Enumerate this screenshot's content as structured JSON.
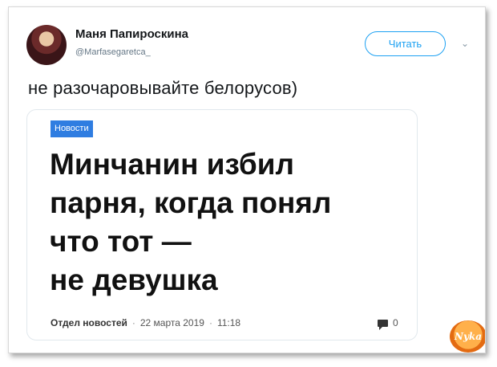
{
  "tweet": {
    "author_name": "Маня Папироскина",
    "author_handle": "@Marfasegaretca_",
    "follow_label": "Читать",
    "caret": "⌄",
    "text": "не разочаровывайте белорусов)"
  },
  "card": {
    "badge": "Новости",
    "headline_lines": [
      "Минчанин избил",
      "парня, когда понял",
      "что тот —",
      "не девушка"
    ],
    "author": "Отдел новостей",
    "sep1": "·",
    "date": "22 марта 2019",
    "sep2": "·",
    "time": "11:18",
    "comments_count": "0"
  },
  "watermark": {
    "text": "Nyka"
  }
}
